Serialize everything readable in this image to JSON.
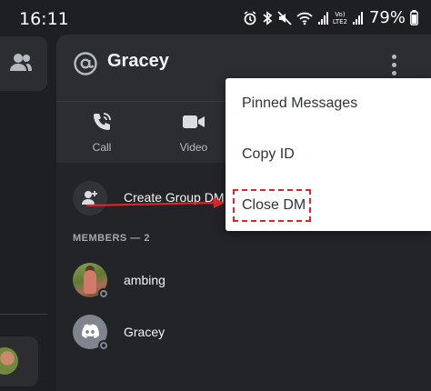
{
  "status_bar": {
    "time": "16:11",
    "network_label_top": "Vo)",
    "network_label_bottom": "LTE2",
    "battery": "79%",
    "icons": [
      "alarm-icon",
      "bluetooth-icon",
      "mute-icon",
      "wifi-icon",
      "signal-icon",
      "volte-icon",
      "signal-icon",
      "battery-icon"
    ]
  },
  "left_rail": {
    "icons": [
      "friends-icon"
    ]
  },
  "dm": {
    "name": "Gracey",
    "icons": [
      "at-icon",
      "more-vertical-icon"
    ]
  },
  "actions": [
    {
      "label": "Call",
      "icon": "phone-icon"
    },
    {
      "label": "Video",
      "icon": "video-camera-icon"
    }
  ],
  "group": {
    "label": "Create Group DM",
    "icon": "add-user-icon"
  },
  "members": {
    "header": "MEMBERS — 2",
    "items": [
      {
        "name": "ambing",
        "avatar": "photo"
      },
      {
        "name": "Gracey",
        "avatar": "discord-default"
      }
    ]
  },
  "context_menu": {
    "items": [
      "Pinned Messages",
      "Copy ID",
      "Close DM"
    ],
    "highlighted": "Close DM"
  },
  "annotation": {
    "arrow_color": "#d9262b",
    "box_color": "#d9262b"
  },
  "colors": {
    "background": "#1e1f22",
    "panel": "#2b2d31",
    "section": "#232428",
    "menu": "#ffffff"
  }
}
